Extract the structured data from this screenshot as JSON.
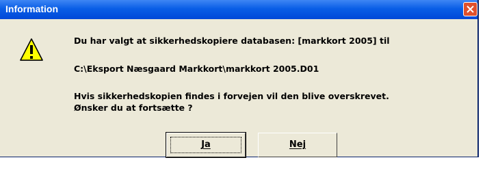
{
  "window": {
    "title": "Information"
  },
  "icon": {
    "name": "warning-icon",
    "color": "#ffff00"
  },
  "message": {
    "line1": "Du har valgt at sikkerhedskopiere databasen: [markkort 2005] til",
    "line2": "C:\\Eksport Næsgaard Markkort\\markkort 2005.D01",
    "line3": "Hvis sikkerhedskopien findes i forvejen vil den blive overskrevet.",
    "line4": "Ønsker du at fortsætte ?"
  },
  "buttons": {
    "yes_label": "Ja",
    "no_label": "Nej"
  },
  "colors": {
    "titlebar": "#0a5ee6",
    "dialog_bg": "#ece9d8",
    "close_button": "#e0502c"
  }
}
